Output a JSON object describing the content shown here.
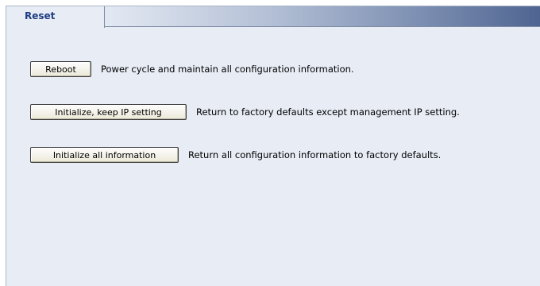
{
  "tabs": {
    "active_label": "Reset"
  },
  "actions": {
    "reboot": {
      "button_label": "Reboot",
      "description": "Power cycle and maintain all configuration information."
    },
    "init_keep_ip": {
      "button_label": "Initialize, keep IP setting",
      "description": "Return to factory defaults except management IP setting."
    },
    "init_all": {
      "button_label": "Initialize all information",
      "description": "Return all configuration information to factory defaults."
    }
  }
}
